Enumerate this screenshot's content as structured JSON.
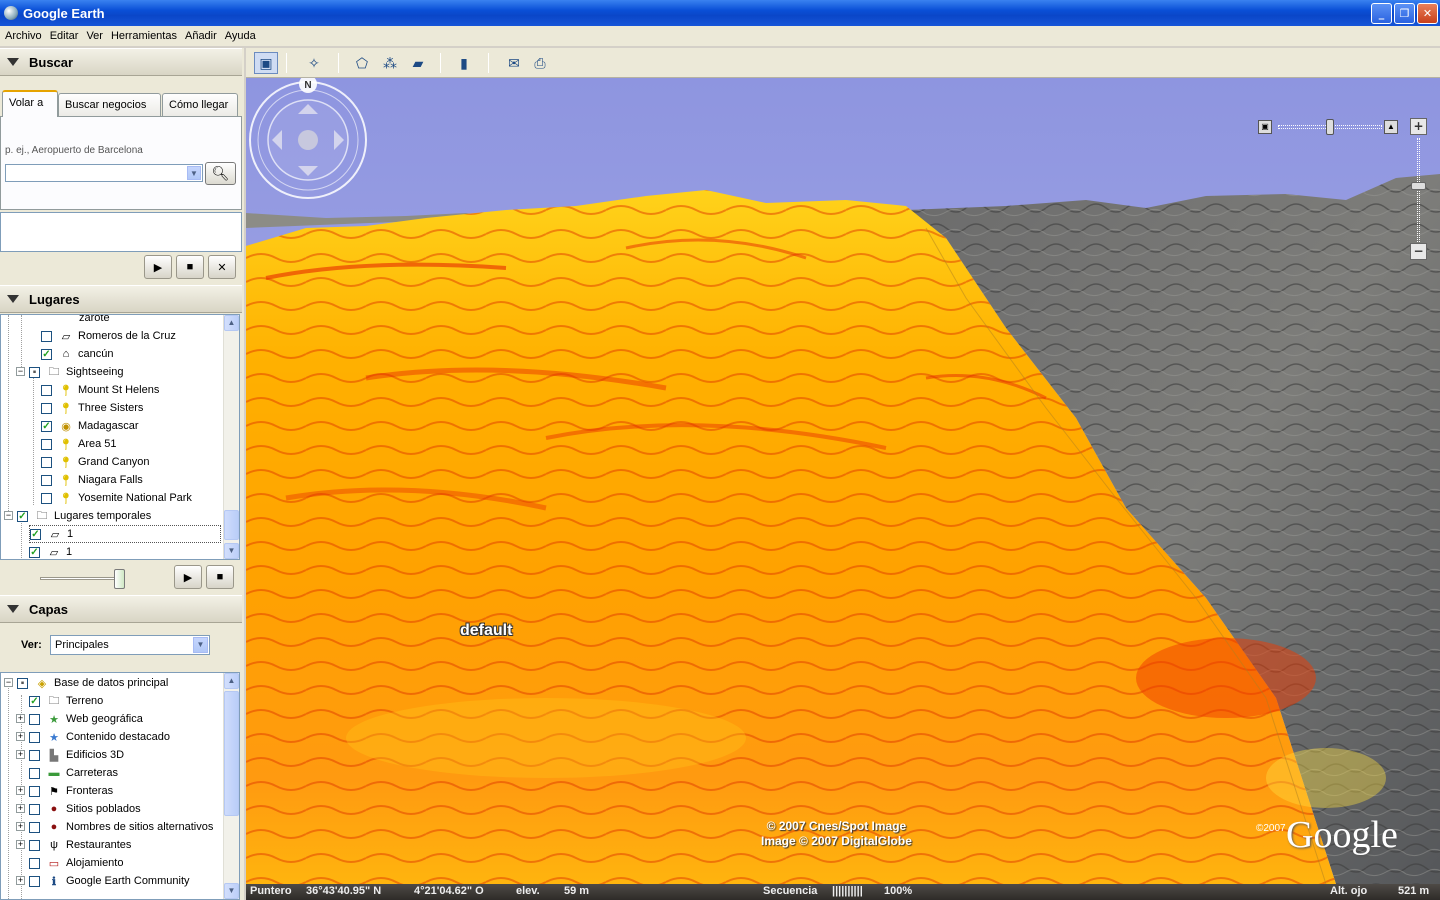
{
  "window": {
    "title": "Google Earth",
    "min": "_",
    "max": "❐",
    "close": "✕"
  },
  "menu": [
    "Archivo",
    "Editar",
    "Ver",
    "Herramientas",
    "Añadir",
    "Ayuda"
  ],
  "search": {
    "header": "Buscar",
    "tabs": [
      "Volar a",
      "Buscar negocios",
      "Cómo llegar"
    ],
    "hint": "p. ej., Aeropuerto de Barcelona",
    "input_value": "",
    "search_icon": "magnifier-icon"
  },
  "lugares": {
    "header": "Lugares",
    "items": [
      {
        "label": "zarote",
        "icon": "",
        "checked": false
      },
      {
        "label": "Romeros de la Cruz",
        "icon": "layers-icon",
        "checked": false
      },
      {
        "label": "cancún",
        "icon": "house-icon",
        "checked": true
      },
      {
        "label": "Sightseeing",
        "icon": "folder-icon",
        "checked": "partial"
      },
      {
        "label": "Mount St Helens",
        "icon": "pushpin-icon",
        "checked": false
      },
      {
        "label": "Three Sisters",
        "icon": "pushpin-icon",
        "checked": false
      },
      {
        "label": "Madagascar",
        "icon": "globe-pin-icon",
        "checked": true
      },
      {
        "label": "Area 51",
        "icon": "pushpin-icon",
        "checked": false
      },
      {
        "label": "Grand Canyon",
        "icon": "pushpin-icon",
        "checked": false
      },
      {
        "label": "Niagara Falls",
        "icon": "pushpin-icon",
        "checked": false
      },
      {
        "label": "Yosemite National Park",
        "icon": "pushpin-icon",
        "checked": false
      },
      {
        "label": "Lugares temporales",
        "icon": "folder-icon",
        "checked": true
      },
      {
        "label": "1",
        "icon": "layers-icon",
        "checked": true
      },
      {
        "label": "1",
        "icon": "layers-icon",
        "checked": true
      }
    ]
  },
  "capas": {
    "header": "Capas",
    "ver_label": "Ver:",
    "ver_value": "Principales",
    "items": [
      {
        "label": "Base de datos principal",
        "icon": "layers-icon",
        "checked": "partial"
      },
      {
        "label": "Terreno",
        "icon": "folder-icon",
        "checked": true
      },
      {
        "label": "Web geográfica",
        "icon": "star-icon",
        "checked": false
      },
      {
        "label": "Contenido destacado",
        "icon": "star-icon",
        "checked": false
      },
      {
        "label": "Edificios 3D",
        "icon": "building-icon",
        "checked": false
      },
      {
        "label": "Carreteras",
        "icon": "road-icon",
        "checked": false
      },
      {
        "label": "Fronteras",
        "icon": "flag-icon",
        "checked": false
      },
      {
        "label": "Sitios poblados",
        "icon": "dot-icon",
        "checked": false
      },
      {
        "label": "Nombres de sitios alternativos",
        "icon": "dot-icon",
        "checked": false
      },
      {
        "label": "Restaurantes",
        "icon": "fork-icon",
        "checked": false
      },
      {
        "label": "Alojamiento",
        "icon": "bed-icon",
        "checked": false
      },
      {
        "label": "Google Earth Community",
        "icon": "info-icon",
        "checked": false
      }
    ]
  },
  "map": {
    "placemark_label": "default",
    "copyright_line1": "© 2007 Cnes/Spot Image",
    "copyright_line2": "Image © 2007 DigitalGlobe",
    "logo_year": "©2007",
    "logo": "Google",
    "compass_north": "N"
  },
  "status": {
    "pointer_label": "Puntero",
    "lat": "36°43'40.95\" N",
    "lon": "4°21'04.62\" O",
    "elev_label": "elev.",
    "elev_value": "59 m",
    "stream_label": "Secuencia",
    "stream_bars": "||||||||||",
    "stream_value": "100%",
    "eye_label": "Alt. ojo",
    "eye_value": "521 m"
  }
}
